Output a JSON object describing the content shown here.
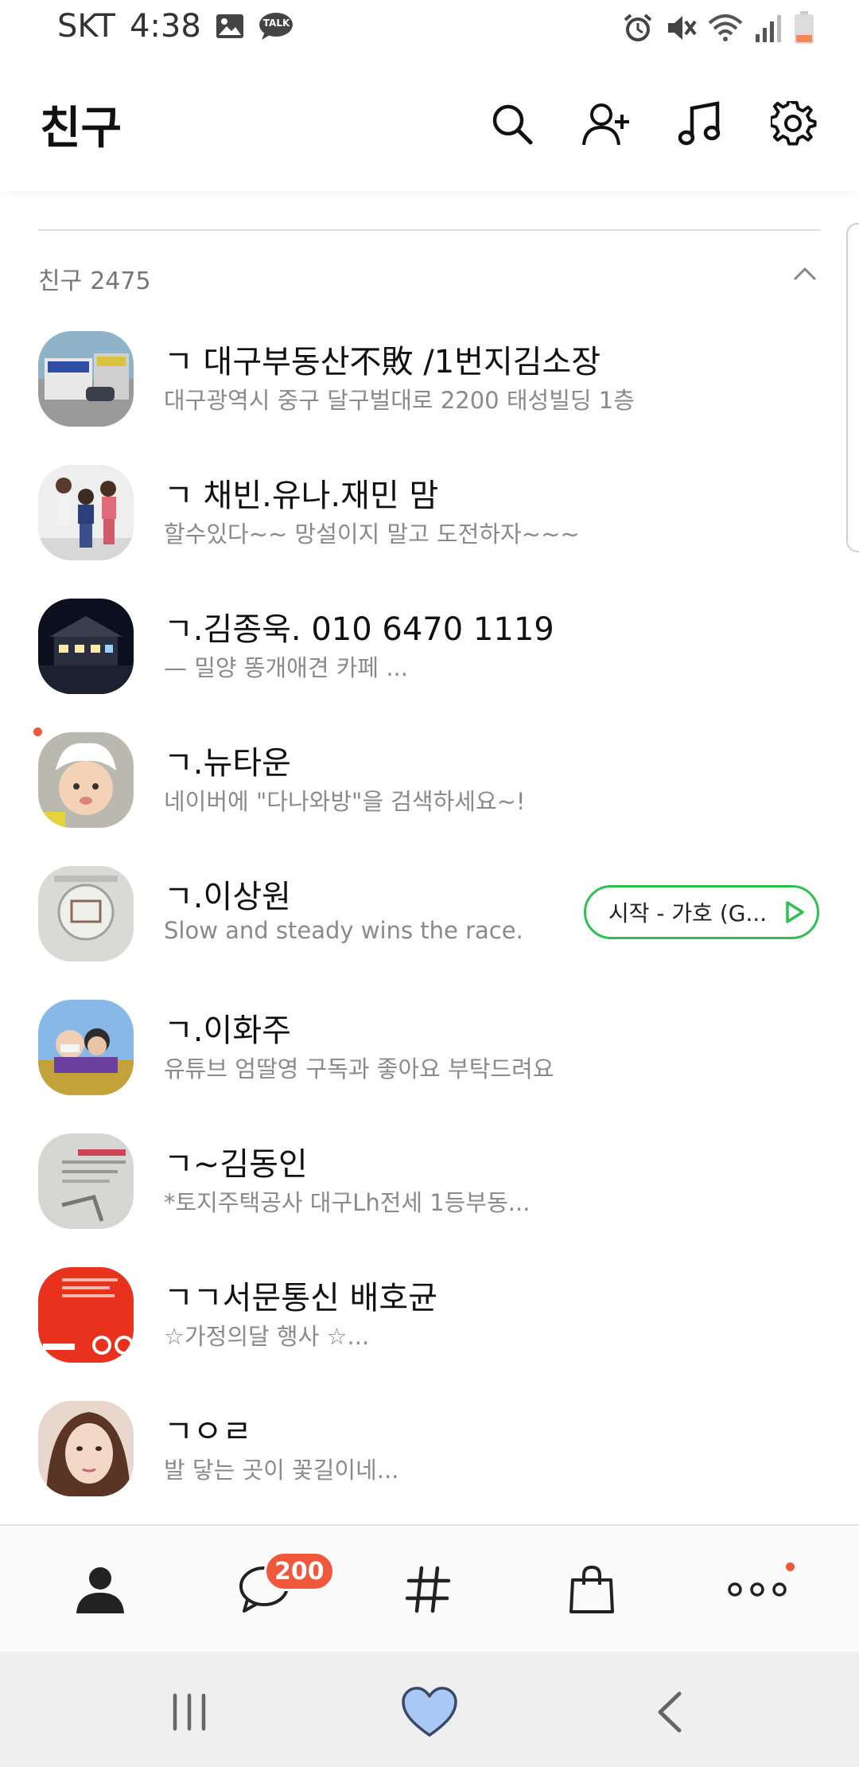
{
  "status_bar": {
    "carrier": "SKT",
    "time": "4:38",
    "talk_badge": "TALK"
  },
  "header": {
    "title": "친구"
  },
  "section": {
    "label": "친구",
    "count": "2475"
  },
  "friends": [
    {
      "name": "ㄱ 대구부동산不敗 /1번지김소장",
      "status": "대구광역시 중구 달구벌대로 2200 태성빌딩 1층"
    },
    {
      "name": "ㄱ 채빈.유나.재민 맘",
      "status": "할수있다~~  망설이지 말고 도전하자~~~"
    },
    {
      "name": "ㄱ.김종욱. 010 6470 1119",
      "status": "— 밀양 똥개애견 카페 ..."
    },
    {
      "name": "ㄱ.뉴타운",
      "status": "네이버에 \"다나와방\"을 검색하세요~!"
    },
    {
      "name": "ㄱ.이상원",
      "status": "Slow and steady wins the race.",
      "music": "시작 - 가호 (G..."
    },
    {
      "name": "ㄱ.이화주",
      "status": "유튜브 엄딸영 구독과 좋아요 부탁드려요"
    },
    {
      "name": "ㄱ~김동인",
      "status": "*토지주택공사 대구Lh전세 1등부동..."
    },
    {
      "name": "ㄱㄱ서문통신 배호균",
      "status": "☆가정의달 행사 ☆..."
    },
    {
      "name": "ㄱㅇㄹ",
      "status": "발 닿는 곳이 꽃길이네..."
    }
  ],
  "bottom_nav": {
    "chats_badge": "200"
  },
  "colors": {
    "badge": "#f1573b",
    "music_border": "#2fc052",
    "heart": "#a9c8f5"
  }
}
